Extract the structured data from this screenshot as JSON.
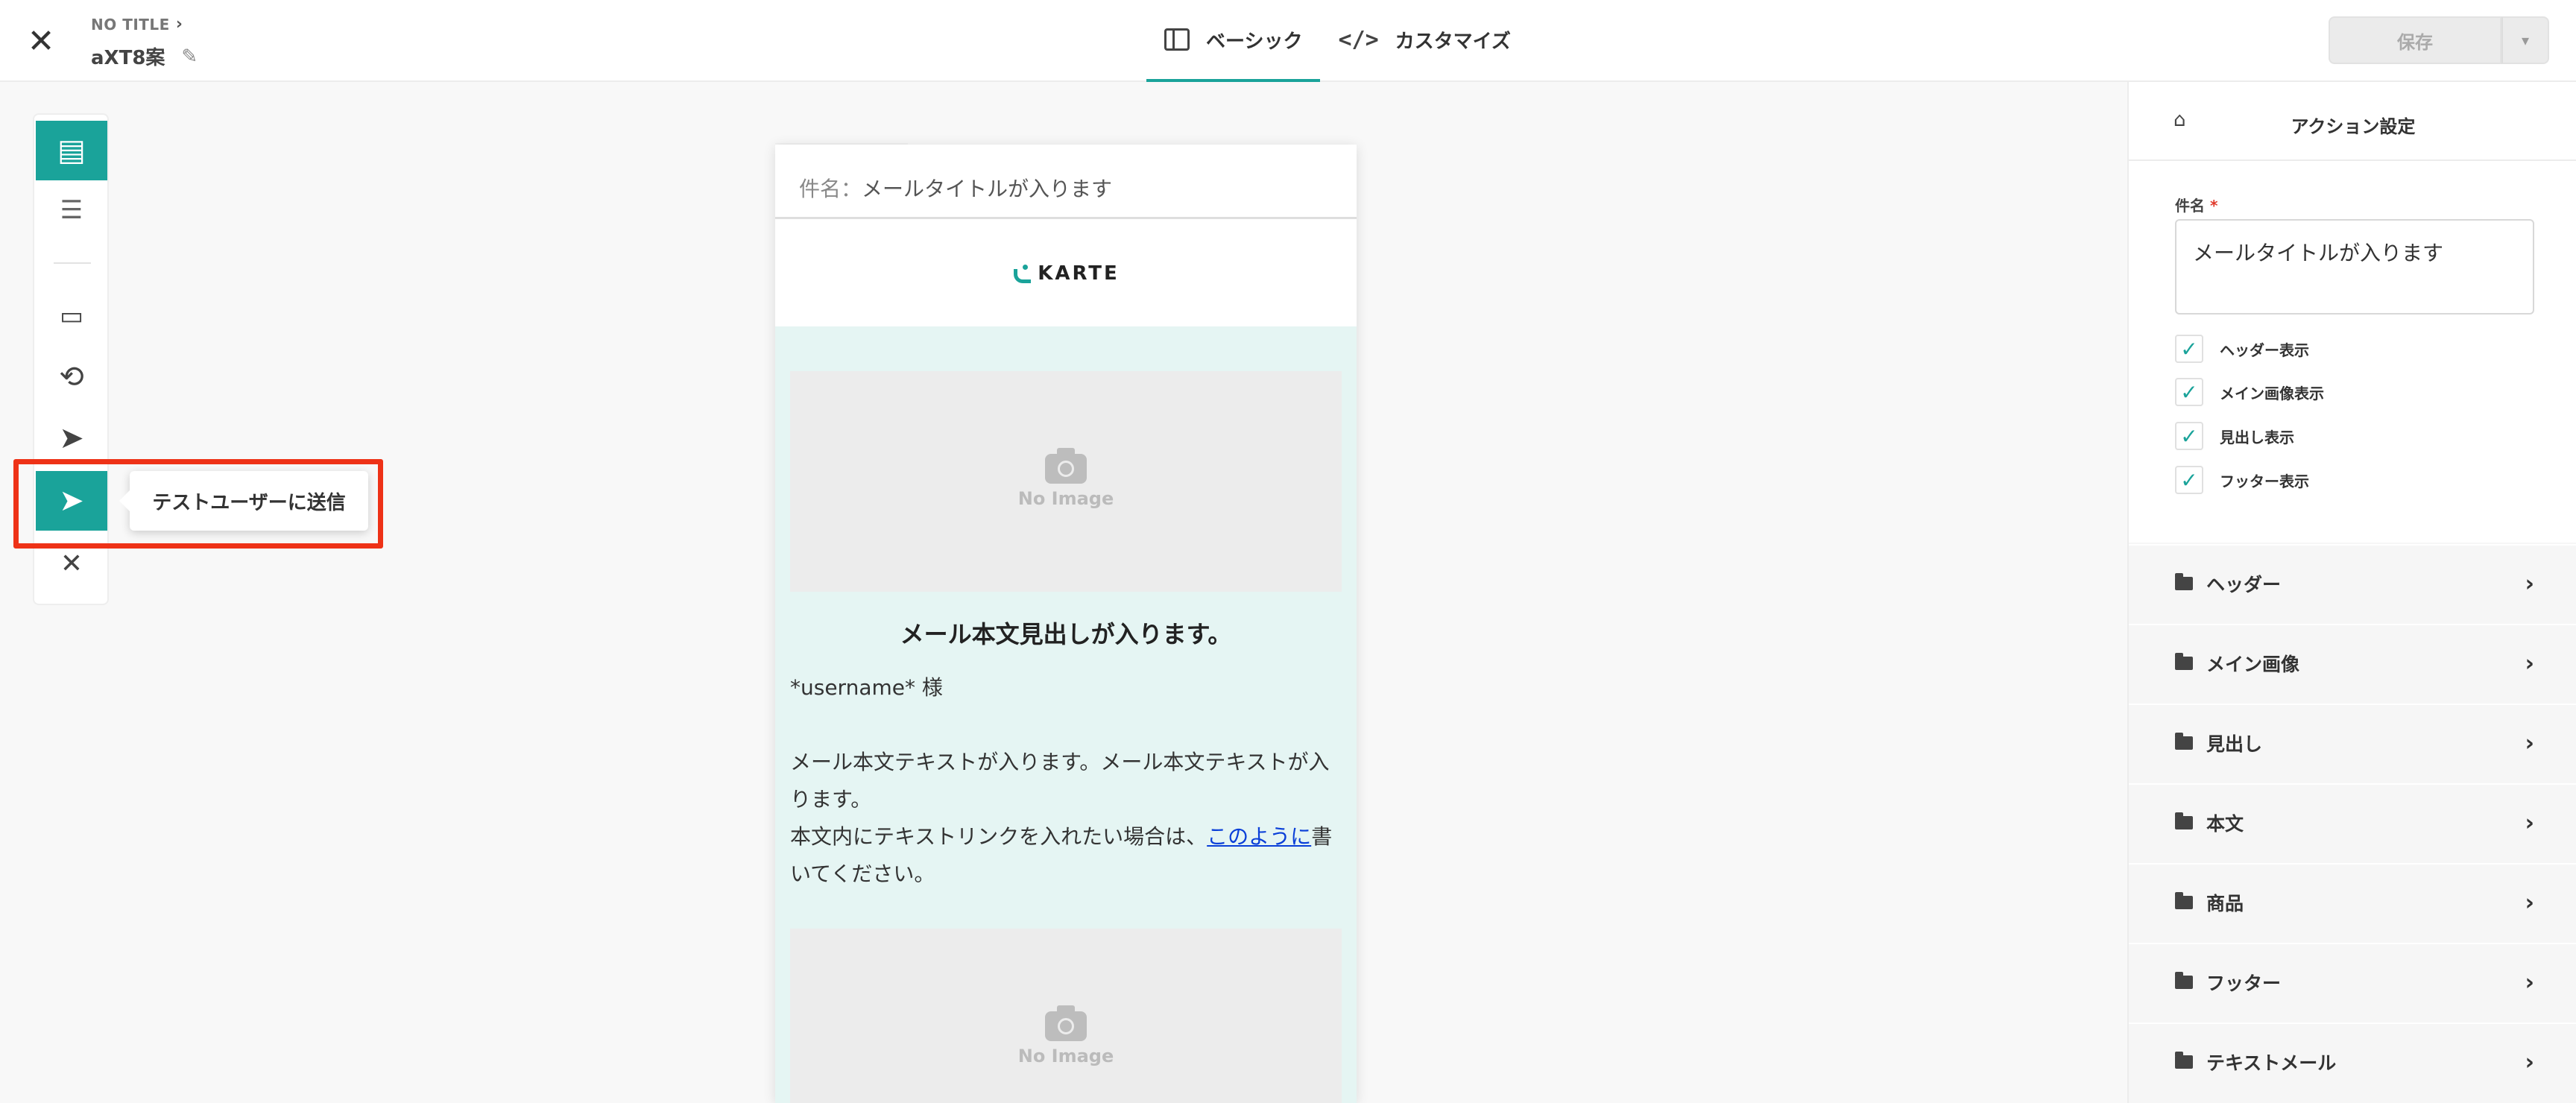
{
  "header": {
    "breadcrumb": "NO TITLE",
    "title": "aXT8案",
    "tabs": [
      {
        "label": "ベーシック",
        "icon": "panel-icon",
        "active": true
      },
      {
        "label": "カスタマイズ",
        "icon": "code-icon",
        "active": false
      }
    ],
    "save_label": "保存"
  },
  "toolbar": {
    "tooltip": "テストユーザーに送信",
    "tools": [
      "layout-template-icon",
      "document-icon",
      "responsive-devices-icon",
      "rotate-device-icon",
      "send-icon",
      "send-test-user-icon",
      "expand-icon"
    ]
  },
  "email": {
    "subject_label": "件名：",
    "subject": "メールタイトルが入ります",
    "logo": "KARTE",
    "no_image": "No Image",
    "heading": "メール本文見出しが入ります。",
    "greeting": "*username* 様",
    "paragraph": "メール本文テキストが入ります。メール本文テキストが入ります。",
    "link_prefix": "本文内にテキストリンクを入れたい場合は、",
    "link_text": "このように",
    "link_suffix": "書いてください。"
  },
  "panel": {
    "title": "アクション設定",
    "subject_label": "件名",
    "required_mark": "*",
    "subject_value": "メールタイトルが入ります",
    "checkboxes": [
      {
        "label": "ヘッダー表示",
        "checked": true
      },
      {
        "label": "メイン画像表示",
        "checked": true
      },
      {
        "label": "見出し表示",
        "checked": true
      },
      {
        "label": "フッター表示",
        "checked": true
      }
    ],
    "sections": [
      "ヘッダー",
      "メイン画像",
      "見出し",
      "本文",
      "商品",
      "フッター",
      "テキストメール"
    ]
  },
  "colors": {
    "accent": "#1aa39a",
    "highlight": "#ee3217",
    "link": "#0a3fd8",
    "email_body_bg": "#e5f5f3"
  }
}
